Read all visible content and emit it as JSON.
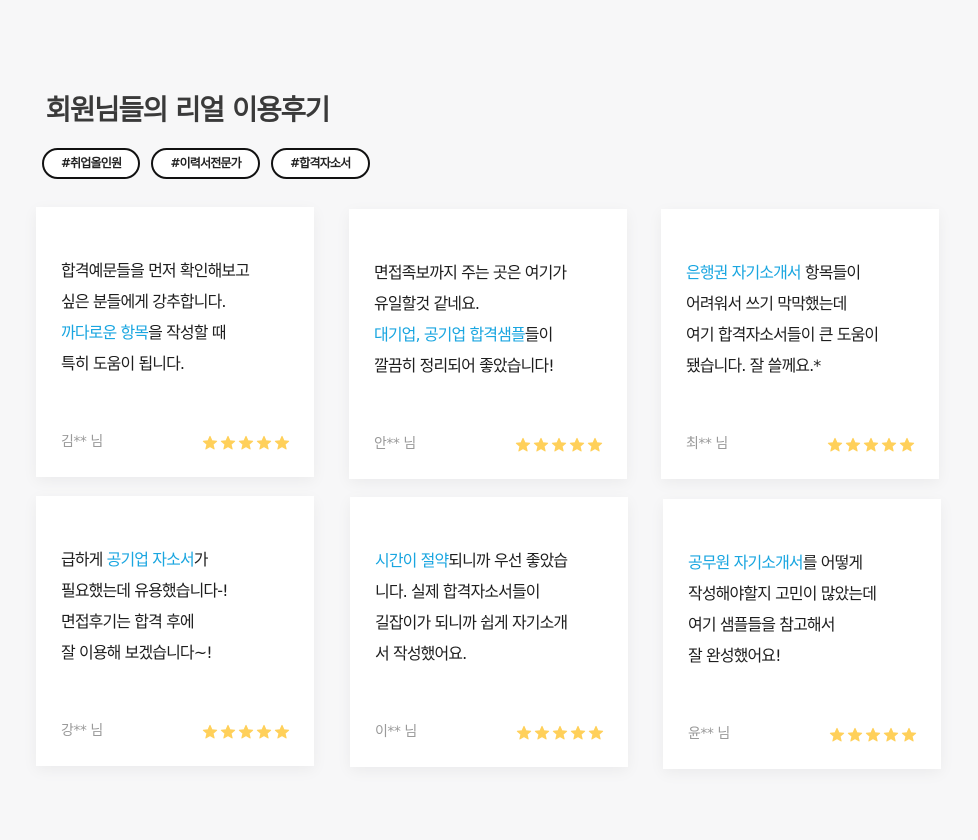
{
  "header": {
    "title": "회원님들의 리얼 이용후기",
    "tags": [
      "#취업올인원",
      "#이력서전문가",
      "#합격자소서"
    ]
  },
  "colors": {
    "highlight": "#1aa6e0",
    "star": "#ffd05a"
  },
  "reviews": [
    {
      "lines": [
        [
          {
            "t": "합격예문들을 먼저 확인해보고"
          }
        ],
        [
          {
            "t": "싶은 분들에게 강추합니다."
          }
        ],
        [
          {
            "t": "까다로운 항목",
            "hl": true
          },
          {
            "t": "을 작성할 때"
          }
        ],
        [
          {
            "t": "특히 도움이 됩니다."
          }
        ]
      ],
      "author": "김** 님",
      "rating": 5
    },
    {
      "lines": [
        [
          {
            "t": "면접족보까지 주는 곳은 여기가"
          }
        ],
        [
          {
            "t": "유일할것 같네요."
          }
        ],
        [
          {
            "t": "대기업, 공기업 합격샘플",
            "hl": true
          },
          {
            "t": "들이"
          }
        ],
        [
          {
            "t": "깔끔히 정리되어 좋았습니다!"
          }
        ]
      ],
      "author": "안** 님",
      "rating": 5
    },
    {
      "lines": [
        [
          {
            "t": "은행권 자기소개서",
            "hl": true
          },
          {
            "t": " 항목들이"
          }
        ],
        [
          {
            "t": "어려워서 쓰기 막막했는데"
          }
        ],
        [
          {
            "t": "여기 합격자소서들이 큰 도움이"
          }
        ],
        [
          {
            "t": "됐습니다. 잘 쓸께요.*"
          }
        ]
      ],
      "author": "최** 님",
      "rating": 5
    },
    {
      "lines": [
        [
          {
            "t": "급하게 "
          },
          {
            "t": "공기업 자소서",
            "hl": true
          },
          {
            "t": "가"
          }
        ],
        [
          {
            "t": "필요했는데 유용했습니다-!"
          }
        ],
        [
          {
            "t": "면접후기는 합격 후에"
          }
        ],
        [
          {
            "t": "잘 이용해 보겠습니다~!"
          }
        ]
      ],
      "author": "강** 님",
      "rating": 5
    },
    {
      "lines": [
        [
          {
            "t": "시간이 절약",
            "hl": true
          },
          {
            "t": "되니까 우선 좋았습"
          }
        ],
        [
          {
            "t": "니다. 실제 합격자소서들이"
          }
        ],
        [
          {
            "t": "길잡이가 되니까 쉽게 자기소개"
          }
        ],
        [
          {
            "t": "서 작성했어요."
          }
        ]
      ],
      "author": "이** 님",
      "rating": 5
    },
    {
      "lines": [
        [
          {
            "t": "공무원 자기소개서",
            "hl": true
          },
          {
            "t": "를 어떻게"
          }
        ],
        [
          {
            "t": "작성해야할지 고민이 많았는데"
          }
        ],
        [
          {
            "t": "여기 샘플들을 참고해서"
          }
        ],
        [
          {
            "t": "잘 완성했어요!"
          }
        ]
      ],
      "author": "윤** 님",
      "rating": 5
    }
  ]
}
